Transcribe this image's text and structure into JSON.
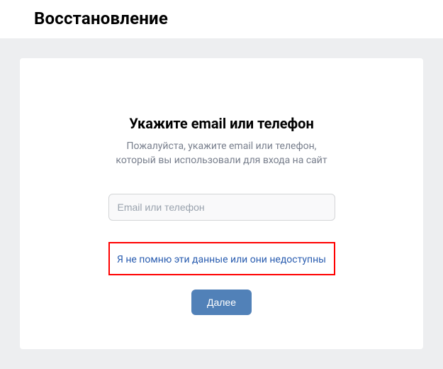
{
  "header": {
    "title": "Восстановление"
  },
  "card": {
    "title": "Укажите email или телефон",
    "subtitle_line1": "Пожалуйста, укажите email или телефон,",
    "subtitle_line2": "который вы использовали для входа на сайт",
    "input_placeholder": "Email или телефон",
    "forgot_link": "Я не помню эти данные или они недоступны",
    "next_button": "Далее"
  }
}
